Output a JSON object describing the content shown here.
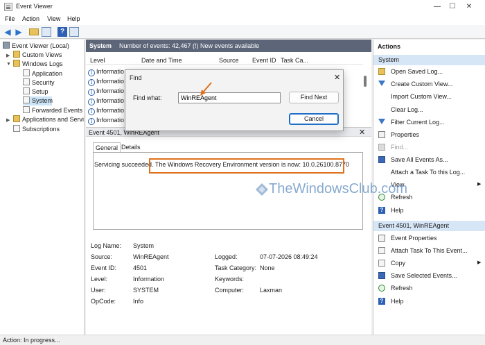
{
  "window": {
    "title": "Event Viewer",
    "minimize": "—",
    "maximize": "☐",
    "close": "✕"
  },
  "menu": {
    "file": "File",
    "action": "Action",
    "view": "View",
    "help": "Help"
  },
  "tree": {
    "root": "Event Viewer (Local)",
    "custom_views": "Custom Views",
    "windows_logs": "Windows Logs",
    "application": "Application",
    "security": "Security",
    "setup": "Setup",
    "system": "System",
    "forwarded": "Forwarded Events",
    "apps_services": "Applications and Servi",
    "subscriptions": "Subscriptions"
  },
  "center": {
    "log_name": "System",
    "summary": "Number of events: 42,467 (!) New events available",
    "columns": {
      "level": "Level",
      "date": "Date and Time",
      "source": "Source",
      "event_id": "Event ID",
      "task": "Task Ca..."
    },
    "rows": [
      "Informatio",
      "Informatio",
      "Informatio",
      "Informatio",
      "Informatio",
      "Informatio"
    ]
  },
  "detail": {
    "header": "Event 4501, WinREAgent",
    "close": "✕",
    "tab_general": "General",
    "tab_details": "Details",
    "desc_prefix": "Servicing succeeded.",
    "desc_highlight": "The Windows Recovery Environment version is now: 10.0.26100.8770",
    "labels": {
      "log_name": "Log Name:",
      "source": "Source:",
      "event_id": "Event ID:",
      "level": "Level:",
      "user": "User:",
      "opcode": "OpCode:",
      "logged": "Logged:",
      "task_category": "Task Category:",
      "keywords": "Keywords:",
      "computer": "Computer:"
    },
    "values": {
      "log_name": "System",
      "source": "WinREAgent",
      "event_id": "4501",
      "level": "Information",
      "user": "SYSTEM",
      "opcode": "Info",
      "logged": "07-07-2026 08:49:24",
      "task_category": "None",
      "computer": "Laxman"
    }
  },
  "find_dialog": {
    "title": "Find",
    "close": "✕",
    "label": "Find what:",
    "value": "WinREAgent",
    "find_next": "Find Next",
    "cancel": "Cancel"
  },
  "actions": {
    "title": "Actions",
    "section_system": "System",
    "open_saved": "Open Saved Log...",
    "create_custom": "Create Custom View...",
    "import_custom": "Import Custom View...",
    "clear_log": "Clear Log...",
    "filter_log": "Filter Current Log...",
    "properties": "Properties",
    "find": "Find...",
    "save_all": "Save All Events As...",
    "attach_task_log": "Attach a Task To this Log...",
    "view": "View",
    "refresh": "Refresh",
    "help": "Help",
    "section_event": "Event 4501, WinREAgent",
    "event_properties": "Event Properties",
    "attach_task_event": "Attach Task To This Event...",
    "copy": "Copy",
    "save_selected": "Save Selected Events...",
    "refresh2": "Refresh",
    "help2": "Help"
  },
  "status": "Action: In progress...",
  "watermark": "TheWindowsClub.com",
  "colors": {
    "highlight_box": "#e0701c",
    "section_header": "#5c6678",
    "actions_section": "#d7e6f7"
  }
}
